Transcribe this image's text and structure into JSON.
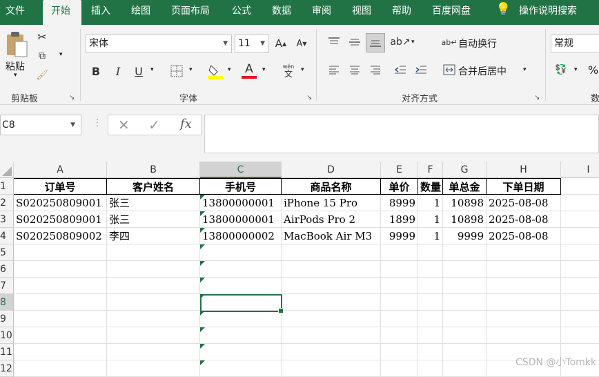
{
  "menu": {
    "tabs": [
      "文件",
      "开始",
      "插入",
      "绘图",
      "页面布局",
      "公式",
      "数据",
      "审阅",
      "视图",
      "帮助",
      "百度网盘"
    ],
    "active_index": 1,
    "tell_me": "操作说明搜索"
  },
  "ribbon": {
    "clipboard": {
      "paste_label": "粘贴",
      "group_label": "剪贴板"
    },
    "font": {
      "font_name": "宋体",
      "font_size": "11",
      "group_label": "字体",
      "bold": "B",
      "italic": "I",
      "underline": "U",
      "font_color_letter": "A"
    },
    "alignment": {
      "wrap_text": "自动换行",
      "merge_center": "合并后居中",
      "group_label": "对齐方式"
    },
    "number": {
      "format": "常规",
      "percent": "%"
    }
  },
  "formula_bar": {
    "name_box": "C8",
    "fx": "fx",
    "formula": ""
  },
  "columns": [
    "A",
    "B",
    "C",
    "D",
    "E",
    "F",
    "G",
    "H",
    "I"
  ],
  "selected_column": "C",
  "rows": [
    "1",
    "2",
    "3",
    "4",
    "5",
    "6",
    "7",
    "8",
    "9",
    "10",
    "11",
    "12"
  ],
  "selected_row": "8",
  "sheet": {
    "headers": [
      "订单号",
      "客户姓名",
      "手机号",
      "商品名称",
      "单价",
      "数量",
      "单总金",
      "下单日期"
    ],
    "records": [
      [
        "S020250809001",
        "张三",
        "13800000001",
        "iPhone 15 Pro",
        "8999",
        "1",
        "10898",
        "2025-08-08"
      ],
      [
        "S020250809001",
        "张三",
        "13800000001",
        "AirPods Pro 2",
        "1899",
        "1",
        "10898",
        "2025-08-08"
      ],
      [
        "S020250809002",
        "李四",
        "13800000002",
        "MacBook Air M3",
        "9999",
        "1",
        "9999",
        "2025-08-08"
      ]
    ]
  },
  "colors": {
    "accent": "#217346",
    "ribbon_bg": "#f3f3f3",
    "highlight_yellow": "#ffff00",
    "font_red": "#e81123"
  },
  "watermark": "CSDN @小Tomkk"
}
